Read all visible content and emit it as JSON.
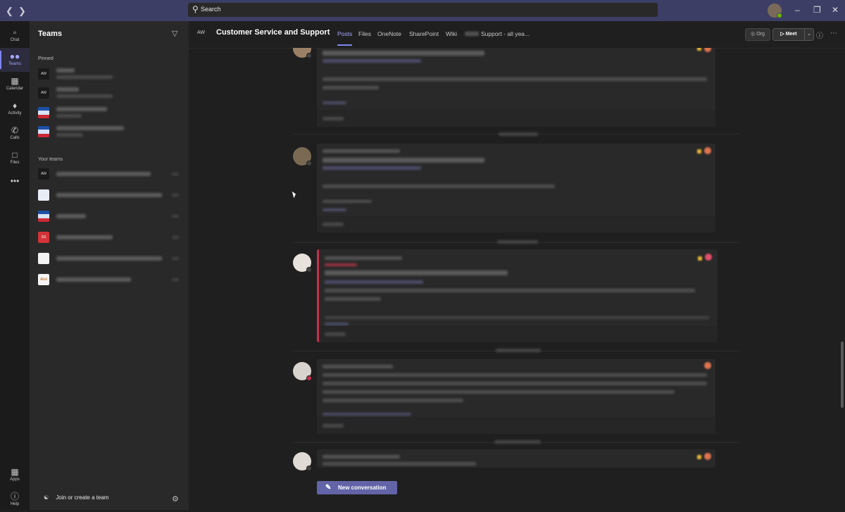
{
  "search": {
    "placeholder": "Search"
  },
  "rail": [
    {
      "name": "chat",
      "label": "Chat",
      "icon": "chat-icon"
    },
    {
      "name": "teams",
      "label": "Teams",
      "icon": "teams-icon"
    },
    {
      "name": "calendar",
      "label": "Calendar",
      "icon": "calendar-icon"
    },
    {
      "name": "activity",
      "label": "Activity",
      "icon": "bell-icon"
    },
    {
      "name": "calls",
      "label": "Calls",
      "icon": "phone-icon"
    },
    {
      "name": "files",
      "label": "Files",
      "icon": "file-icon"
    },
    {
      "name": "apps",
      "label": "Apps",
      "icon": "apps-icon"
    },
    {
      "name": "help",
      "label": "Help",
      "icon": "help-icon"
    }
  ],
  "panel": {
    "title": "Teams",
    "pinned_label": "Pinned",
    "your_teams_label": "Your teams",
    "join_label": "Join or create a team"
  },
  "pinned_icons": [
    "AW",
    "AW",
    "",
    ""
  ],
  "team_icons": [
    "AW",
    "",
    "",
    "SS",
    "",
    "Akal"
  ],
  "channel": {
    "abbr": "AW",
    "title": "Customer Service and Support",
    "tabs": [
      "Posts",
      "Files",
      "OneNote",
      "SharePoint",
      "Wiki",
      "Support - all yea..."
    ],
    "org_label": "Org",
    "meet_label": "Meet"
  },
  "new_conversation_label": "New conversation",
  "colors": {
    "titlebar": "#3d3e66",
    "accent": "#7f85f5",
    "button": "#6264a7",
    "urgent": "#c4314b"
  }
}
